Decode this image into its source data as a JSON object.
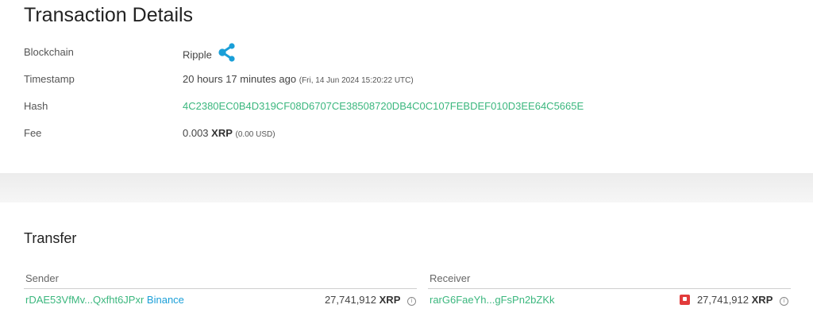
{
  "page": {
    "title": "Transaction Details"
  },
  "details": {
    "blockchain_label": "Blockchain",
    "blockchain_value": "Ripple",
    "blockchain_icon": "ripple-logo-icon",
    "timestamp_label": "Timestamp",
    "timestamp_relative": "20 hours 17 minutes ago",
    "timestamp_absolute": "(Fri, 14 Jun 2024 15:20:22 UTC)",
    "hash_label": "Hash",
    "hash_value": "4C2380EC0B4D319CF08D6707CE38508720DB4C0C107FEBDEF010D3EE64C5665E",
    "fee_label": "Fee",
    "fee_amount": "0.003",
    "fee_currency": "XRP",
    "fee_usd": "(0.00 USD)"
  },
  "transfer": {
    "title": "Transfer",
    "sender_header": "Sender",
    "receiver_header": "Receiver",
    "sender_address": "rDAE53VfMv...Qxfht6JPxr",
    "sender_tag": "Binance",
    "sender_amount": "27,741,912",
    "sender_currency": "XRP",
    "receiver_address": "rarG6FaeYh...gFsPn2bZKk",
    "receiver_amount": "27,741,912",
    "receiver_currency": "XRP",
    "receiver_flag_icon": "warning-flag-icon",
    "info_icon": "info-icon"
  },
  "colors": {
    "link_green": "#3bb77e",
    "link_blue": "#1a9fd8",
    "ripple_blue": "#1a9fd8",
    "flag_red": "#e23b3b"
  }
}
